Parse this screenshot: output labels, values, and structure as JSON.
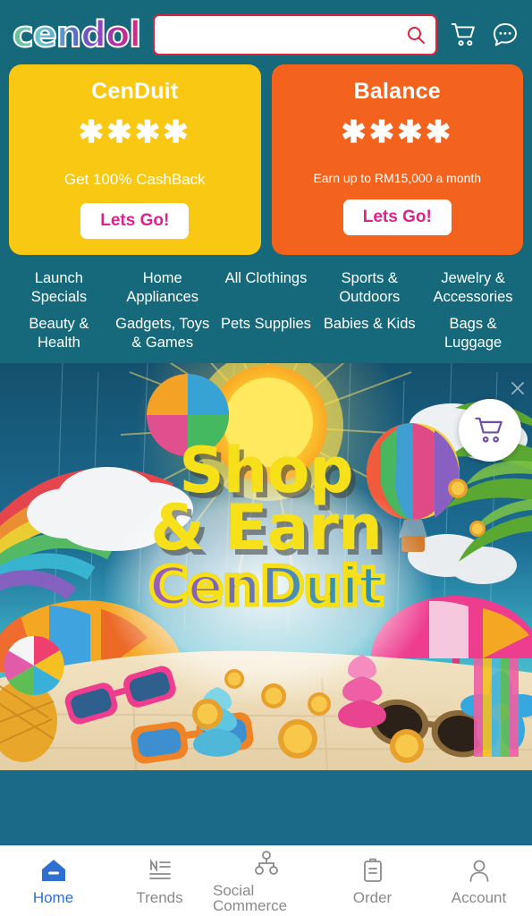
{
  "theme": {
    "teal": "#15697a",
    "gold": "#f9c812",
    "amber": "#f4631e",
    "accent_pink": "#e0218a",
    "search_border": "#d9243f",
    "nav_active": "#2f6fd0",
    "banner_yellow": "#f5e01a"
  },
  "header": {
    "logo_text": "cendol",
    "search": {
      "value": "",
      "placeholder": ""
    },
    "search_icon": "search-icon",
    "cart_icon": "cart-icon",
    "chat_icon": "chat-bubble-icon"
  },
  "promos": [
    {
      "title": "CenDuit",
      "amount": "✱✱✱✱",
      "subtitle": "Get 100% CashBack",
      "button_label": "Lets Go!",
      "color": "#f9c812"
    },
    {
      "title": "Balance",
      "amount": "✱✱✱✱",
      "subtitle": "Earn up to RM15,000 a month",
      "button_label": "Lets Go!",
      "color": "#f4631e"
    }
  ],
  "categories": [
    {
      "label": "Launch Specials"
    },
    {
      "label": "Home Appliances"
    },
    {
      "label": "All Clothings"
    },
    {
      "label": "Sports & Outdoors"
    },
    {
      "label": "Jewelry & Accessories"
    },
    {
      "label": "Beauty & Health"
    },
    {
      "label": "Gadgets, Toys & Games"
    },
    {
      "label": "Pets Supplies"
    },
    {
      "label": "Babies & Kids"
    },
    {
      "label": "Bags & Luggage"
    }
  ],
  "banner": {
    "line1": "Shop",
    "line2": "& Earn",
    "line3": "CenDuit",
    "float_cart_icon": "shopping-cart-icon",
    "close_icon": "close-icon"
  },
  "bottom_nav": [
    {
      "label": "Home",
      "icon": "home-icon",
      "active": true
    },
    {
      "label": "Trends",
      "icon": "news-icon",
      "active": false
    },
    {
      "label": "Social Commerce",
      "icon": "sitemap-icon",
      "active": false
    },
    {
      "label": "Order",
      "icon": "clipboard-icon",
      "active": false
    },
    {
      "label": "Account",
      "icon": "person-icon",
      "active": false
    }
  ]
}
